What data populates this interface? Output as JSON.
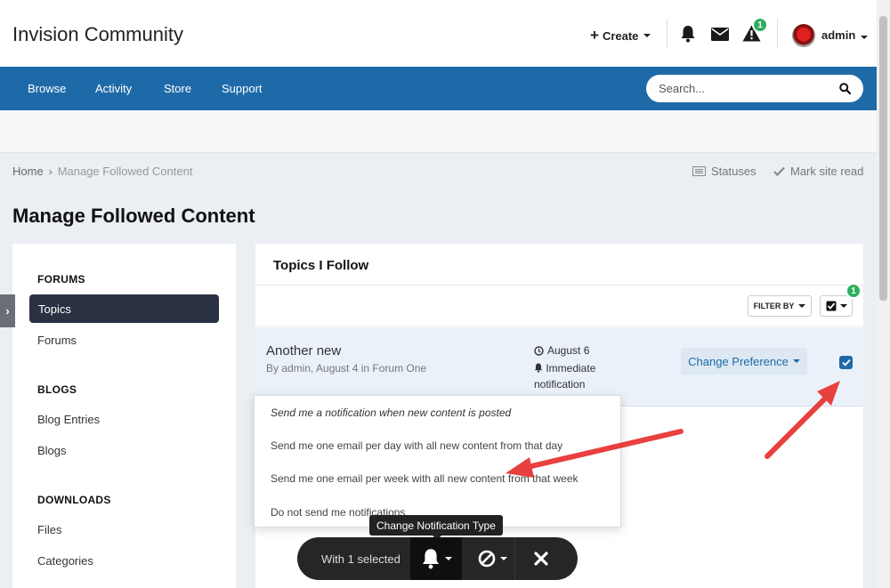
{
  "header": {
    "site_title": "Invision Community",
    "create_label": "Create",
    "warnings_badge": "1",
    "user_name": "admin"
  },
  "nav": {
    "items": [
      "Browse",
      "Activity",
      "Store",
      "Support"
    ],
    "search_placeholder": "Search..."
  },
  "breadcrumb": {
    "home": "Home",
    "current": "Manage Followed Content"
  },
  "breadcrumb_actions": {
    "statuses": "Statuses",
    "mark_read": "Mark site read"
  },
  "page": {
    "title": "Manage Followed Content"
  },
  "sidebar": {
    "sections": [
      {
        "heading": "FORUMS",
        "items": [
          "Topics",
          "Forums"
        ]
      },
      {
        "heading": "BLOGS",
        "items": [
          "Blog Entries",
          "Blogs"
        ]
      },
      {
        "heading": "DOWNLOADS",
        "items": [
          "Files",
          "Categories"
        ]
      }
    ],
    "active_item": "Topics"
  },
  "panel": {
    "title": "Topics I Follow",
    "filter_label": "FILTER BY",
    "selected_badge": "1"
  },
  "topic_row": {
    "title": "Another new",
    "meta": "By admin, August 4 in Forum One",
    "date": "August 6",
    "notification": "Immediate notification",
    "preference_label": "Change Preference",
    "checked": true
  },
  "dropdown": {
    "options": [
      "Send me a notification when new content is posted",
      "Send me one email per day with all new content from that day",
      "Send me one email per week with all new content from that week",
      "Do not send me notifications"
    ],
    "selected_index": 0
  },
  "tooltip": {
    "text": "Change Notification Type"
  },
  "bulk_bar": {
    "label": "With 1 selected"
  },
  "colors": {
    "nav_blue": "#1e6aa8",
    "badge_green": "#2eaf5c",
    "arrow_red": "#e8403f",
    "sidebar_active": "#2a3142"
  }
}
